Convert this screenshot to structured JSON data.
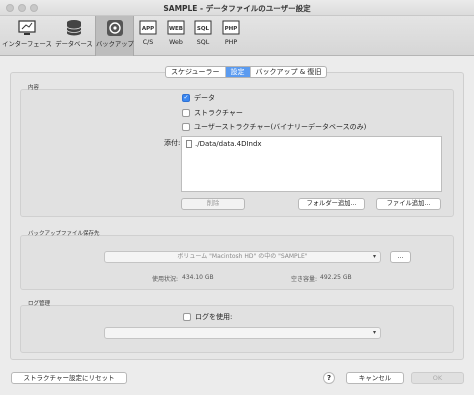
{
  "window": {
    "title": "SAMPLE - データファイルのユーザー設定"
  },
  "toolbar": {
    "items": [
      {
        "label": "インターフェース",
        "icon": "interface-icon"
      },
      {
        "label": "データベース",
        "icon": "database-icon"
      },
      {
        "label": "バックアップ",
        "icon": "backup-icon",
        "active": true
      },
      {
        "label": "C/S",
        "icon": "app-icon",
        "icon_text": "APP"
      },
      {
        "label": "Web",
        "icon": "web-icon",
        "icon_text": "WEB"
      },
      {
        "label": "SQL",
        "icon": "sql-icon",
        "icon_text": "SQL"
      },
      {
        "label": "PHP",
        "icon": "php-icon",
        "icon_text": "PHP"
      }
    ]
  },
  "tabs": [
    {
      "label": "スケジューラー"
    },
    {
      "label": "設定",
      "selected": true
    },
    {
      "label": "バックアップ & 復旧"
    }
  ],
  "content_group": {
    "title": "内容",
    "checkboxes": [
      {
        "label": "データ",
        "checked": true
      },
      {
        "label": "ストラクチャー",
        "checked": false
      },
      {
        "label": "ユーザーストラクチャー(バイナリーデータベースのみ)",
        "checked": false
      }
    ],
    "attach_label": "添付:",
    "attachments": [
      "./Data/data.4DIndx"
    ],
    "delete_button": "削除",
    "add_folder_button": "フォルダー追加...",
    "add_file_button": "ファイル追加..."
  },
  "backup_location_group": {
    "title": "バックアップファイル保存先",
    "location_value": "ボリューム \"Macintosh HD\" の中の \"SAMPLE\"",
    "browse_button": "...",
    "used_label": "使用状況:",
    "used_value": "434.10 GB",
    "free_label": "空き容量:",
    "free_value": "492.25 GB"
  },
  "log_group": {
    "title": "ログ管理",
    "use_log_label": "ログを使用:",
    "use_log_checked": false,
    "log_path_value": ""
  },
  "footer": {
    "reset_button": "ストラクチャー設定にリセット",
    "help_button": "?",
    "cancel_button": "キャンセル",
    "ok_button": "OK"
  },
  "colors": {
    "accent": "#3b87f0",
    "selected_tab": "#5b9bf0"
  }
}
